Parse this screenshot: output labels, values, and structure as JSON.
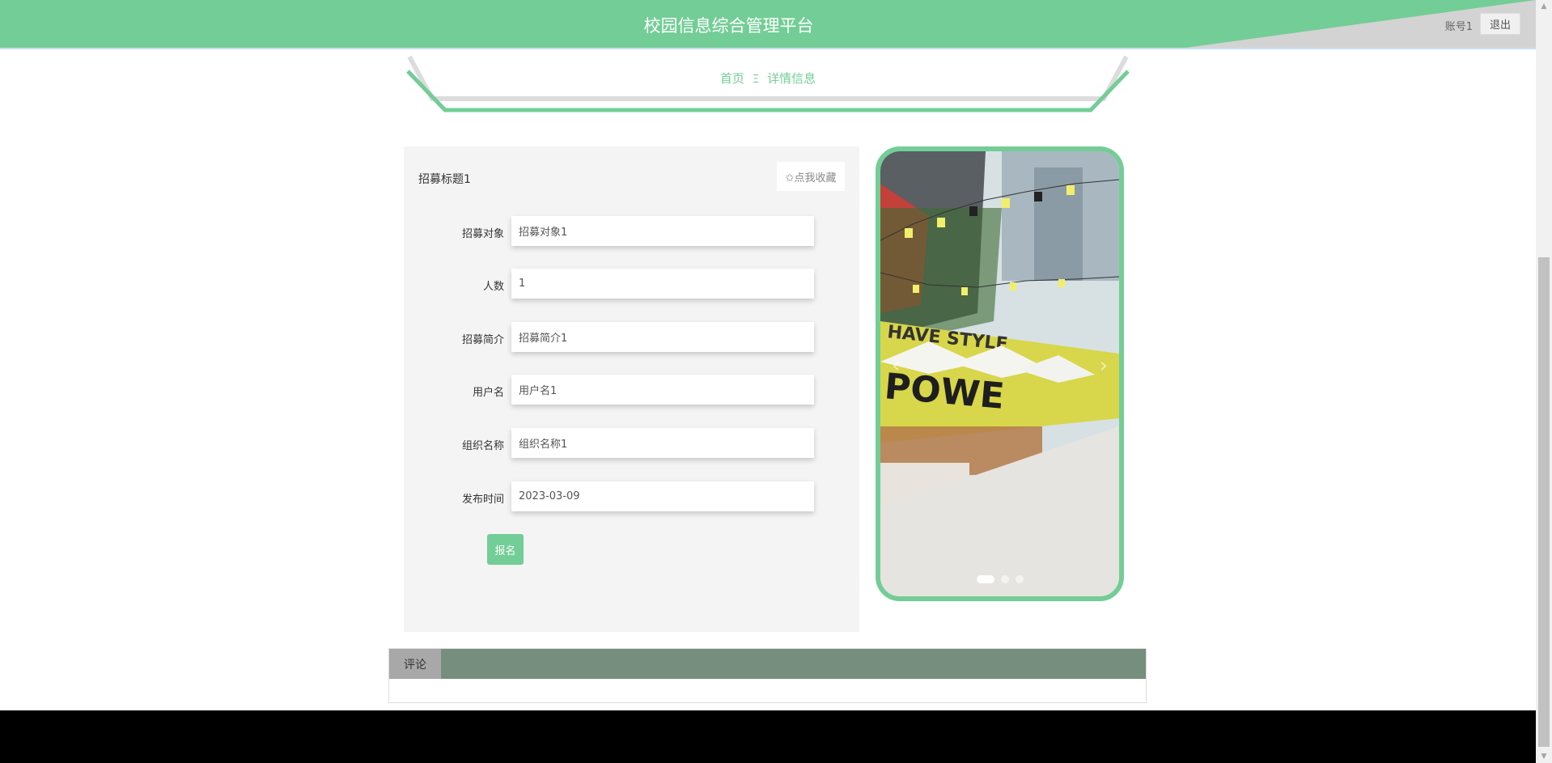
{
  "header": {
    "title": "校园信息综合管理平台",
    "account": "账号1",
    "logout": "退出"
  },
  "breadcrumb": {
    "home": "首页",
    "separator": "Ξ",
    "current": "详情信息"
  },
  "detail": {
    "title": "招募标题1",
    "collect": "✩点我收藏",
    "fields": [
      {
        "label": "招募对象",
        "value": "招募对象1"
      },
      {
        "label": "人数",
        "value": "1"
      },
      {
        "label": "招募简介",
        "value": "招募简介1"
      },
      {
        "label": "用户名",
        "value": "用户名1"
      },
      {
        "label": "组织名称",
        "value": "组织名称1"
      },
      {
        "label": "发布时间",
        "value": "2023-03-09"
      }
    ],
    "signup": "报名"
  },
  "carousel": {
    "prev": "‹",
    "next": "›",
    "slide_count": 3,
    "active_index": 0,
    "sign_text": "HAVE STYLE",
    "wall_text": "POWE"
  },
  "comments": {
    "tab": "评论"
  },
  "colors": {
    "accent": "#73cd96",
    "comments_bar": "#758e7e"
  }
}
